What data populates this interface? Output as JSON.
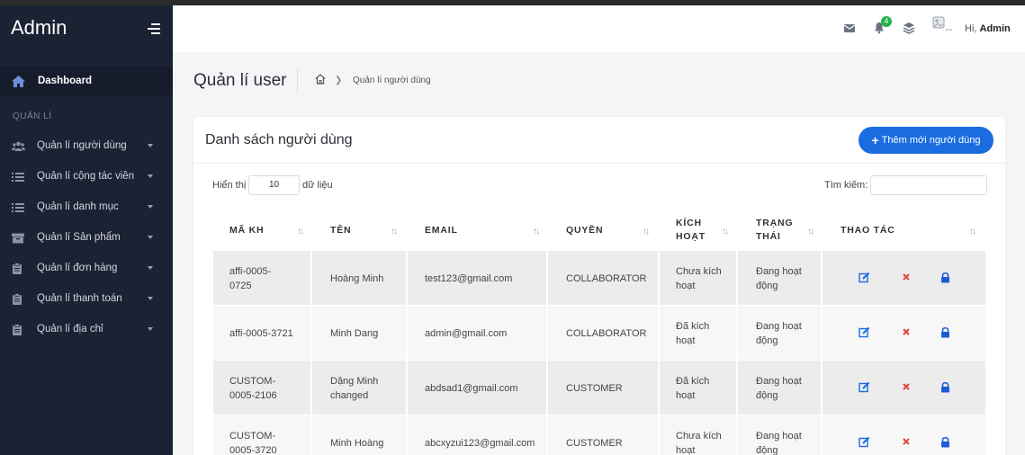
{
  "sidebar": {
    "brand": "Admin",
    "dashboard": "Dashboard",
    "section": "QUẢN LÍ",
    "items": [
      {
        "label": "Quản lí người dùng",
        "icon": "users-icon"
      },
      {
        "label": "Quản lí cộng tác viên",
        "icon": "list-icon"
      },
      {
        "label": "Quản lí danh mục",
        "icon": "list-icon"
      },
      {
        "label": "Quản lí Sản phẩm",
        "icon": "box-icon"
      },
      {
        "label": "Quản lí đơn hàng",
        "icon": "clipboard-icon"
      },
      {
        "label": "Quản lí thanh toán",
        "icon": "clipboard-icon"
      },
      {
        "label": "Quản lí địa chỉ",
        "icon": "clipboard-icon"
      }
    ]
  },
  "topbar": {
    "notification_count": "4",
    "greeting_prefix": "Hi, ",
    "user": "Admin"
  },
  "page": {
    "title": "Quản lí user",
    "breadcrumb": "Quản lí người dùng"
  },
  "card": {
    "title": "Danh sách người dùng",
    "add_button": "Thêm mới người dùng",
    "show_label": "Hiển thị",
    "show_value": "10",
    "show_suffix": "dữ liệu",
    "search_label": "Tìm kiếm:"
  },
  "table": {
    "headers": [
      "MÃ KH",
      "TÊN",
      "EMAIL",
      "QUYỀN",
      "KÍCH\nHOẠT",
      "TRẠNG\nTHÁI",
      "THAO TÁC"
    ],
    "rows": [
      {
        "id": "affi-0005-\n0725",
        "name": "Hoàng Minh",
        "email": "test123@gmail.com",
        "role": "COLLABORATOR",
        "active": "Chưa kích\nhoạt",
        "status": "Đang hoạt\nđộng"
      },
      {
        "id": "affi-0005-3721",
        "name": "Minh Dang",
        "email": "admin@gmail.com",
        "role": "COLLABORATOR",
        "active": "Đã kích\nhoạt",
        "status": "Đang hoạt\nđộng"
      },
      {
        "id": "CUSTOM-\n0005-2106",
        "name": "Dặng Minh\nchanged",
        "email": "abdsad1@gmail.com",
        "role": "CUSTOMER",
        "active": "Đã kích\nhoạt",
        "status": "Đang hoạt\nđộng"
      },
      {
        "id": "CUSTOM-\n0005-3720",
        "name": "Minh Hoàng",
        "email": "abcxyzui123@gmail.com",
        "role": "CUSTOMER",
        "active": "Chưa kích\nhoạt",
        "status": "Đang hoạt\nđộng"
      }
    ]
  },
  "colors": {
    "sidebar": "#1b2234",
    "accent": "#1a6ce0",
    "edit": "#1a6ce0",
    "delete": "#e0463f",
    "lock": "#1a5bd6",
    "badge": "#22b14c"
  }
}
